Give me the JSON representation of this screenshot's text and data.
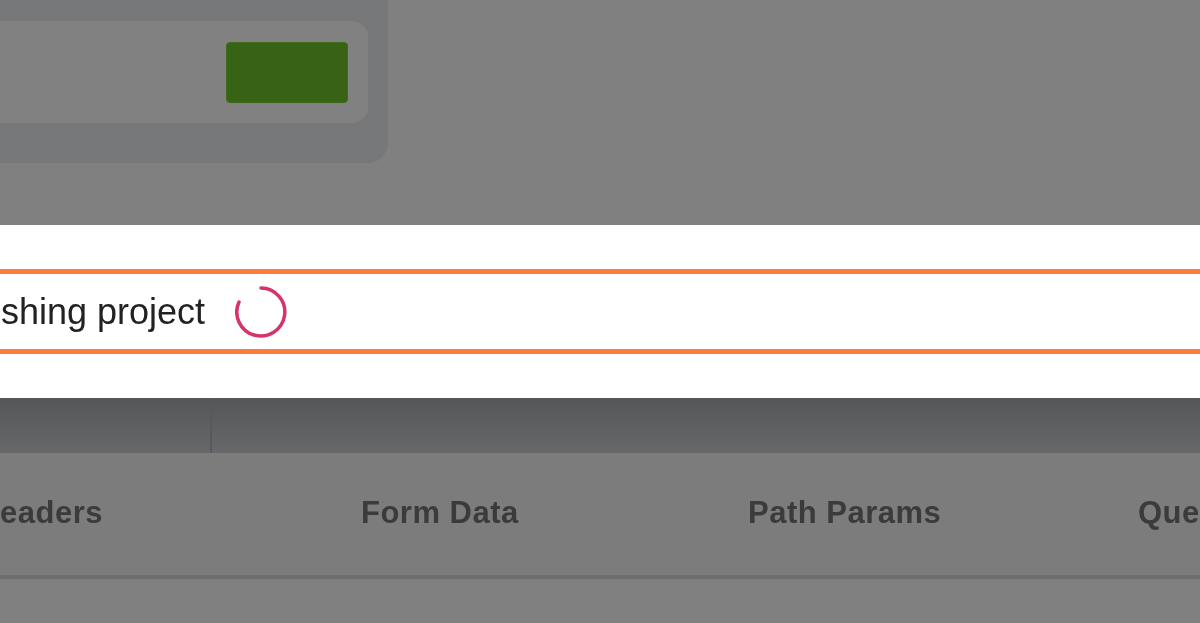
{
  "toast": {
    "message": "shing project",
    "loading": true
  },
  "tabs": [
    {
      "label": "eaders",
      "selected": false
    },
    {
      "label": "Form Data",
      "selected": false
    },
    {
      "label": "Path Params",
      "selected": false
    },
    {
      "label": "Que",
      "selected": false
    }
  ]
}
